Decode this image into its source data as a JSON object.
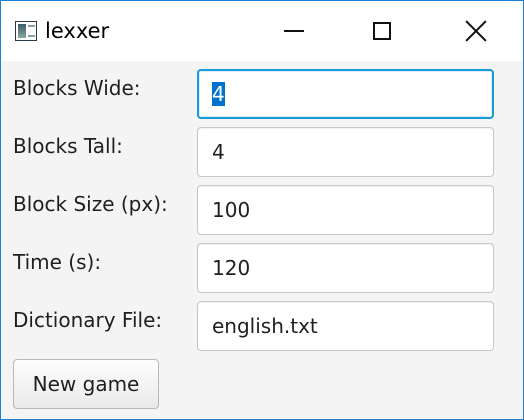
{
  "window": {
    "title": "lexxer",
    "controls": {
      "minimize_icon": "minimize-icon",
      "maximize_icon": "maximize-icon",
      "close_icon": "close-icon"
    },
    "accent": "#1a7fd6"
  },
  "form": {
    "fields": [
      {
        "label": "Blocks Wide:",
        "value": "4",
        "focused": true
      },
      {
        "label": "Blocks Tall:",
        "value": "4"
      },
      {
        "label": "Block Size (px):",
        "value": "100"
      },
      {
        "label": "Time (s):",
        "value": "120"
      },
      {
        "label": "Dictionary File:",
        "value": "english.txt"
      }
    ],
    "selection_color": "#0071ce",
    "focus_border_color": "#1a9bd7"
  },
  "actions": {
    "new_game_label": "New game"
  }
}
